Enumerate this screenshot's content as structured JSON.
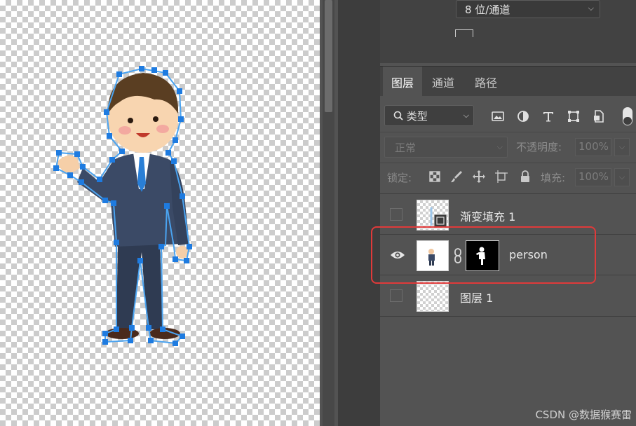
{
  "document": {
    "bit_depth": "8 位/通道"
  },
  "panel": {
    "tabs": [
      {
        "label": "图层",
        "active": true
      },
      {
        "label": "通道",
        "active": false
      },
      {
        "label": "路径",
        "active": false
      }
    ],
    "filter": {
      "kind_label": "类型",
      "icons": [
        "search-icon",
        "image-filter-icon",
        "adjustment-filter-icon",
        "type-filter-icon",
        "shape-filter-icon",
        "smart-object-filter-icon"
      ]
    },
    "blend": {
      "mode": "正常",
      "opacity_label": "不透明度:",
      "opacity_value": "100%"
    },
    "lock": {
      "label": "锁定:",
      "fill_label": "填充:",
      "fill_value": "100%",
      "icons": [
        "lock-transparent-icon",
        "lock-paint-icon",
        "lock-position-icon",
        "lock-artboard-icon",
        "lock-all-icon"
      ]
    },
    "layers": [
      {
        "name": "渐变填充 1",
        "visible": false,
        "has_mask": false
      },
      {
        "name": "person",
        "visible": true,
        "has_mask": true,
        "highlighted": true
      },
      {
        "name": "图层 1",
        "visible": false,
        "has_mask": false
      }
    ]
  },
  "watermark": "CSDN @数据猴赛雷",
  "colors": {
    "highlight": "#e03a3a",
    "path_anchor": "#1e7be0"
  }
}
